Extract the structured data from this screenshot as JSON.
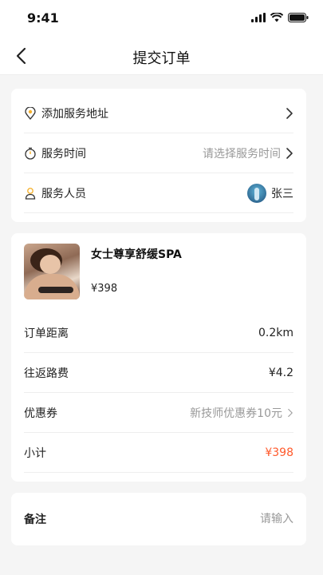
{
  "status_bar": {
    "time": "9:41"
  },
  "nav": {
    "title": "提交订单"
  },
  "service_info": {
    "address_label": "添加服务地址",
    "time_label": "服务时间",
    "time_placeholder": "请选择服务时间",
    "staff_label": "服务人员",
    "staff_name": "张三"
  },
  "product": {
    "name": "女士尊享舒缓SPA",
    "price": "¥398"
  },
  "order": {
    "distance_label": "订单距离",
    "distance_value": "0.2km",
    "travel_fee_label": "往返路费",
    "travel_fee_value": "¥4.2",
    "coupon_label": "优惠券",
    "coupon_value": "新技师优惠券10元",
    "subtotal_label": "小计",
    "subtotal_value": "¥398"
  },
  "remark": {
    "label": "备注",
    "placeholder": "请输入"
  },
  "colors": {
    "accent": "#ff5a2c",
    "address_icon": "#f5b230",
    "staff_icon": "#f5b230"
  }
}
